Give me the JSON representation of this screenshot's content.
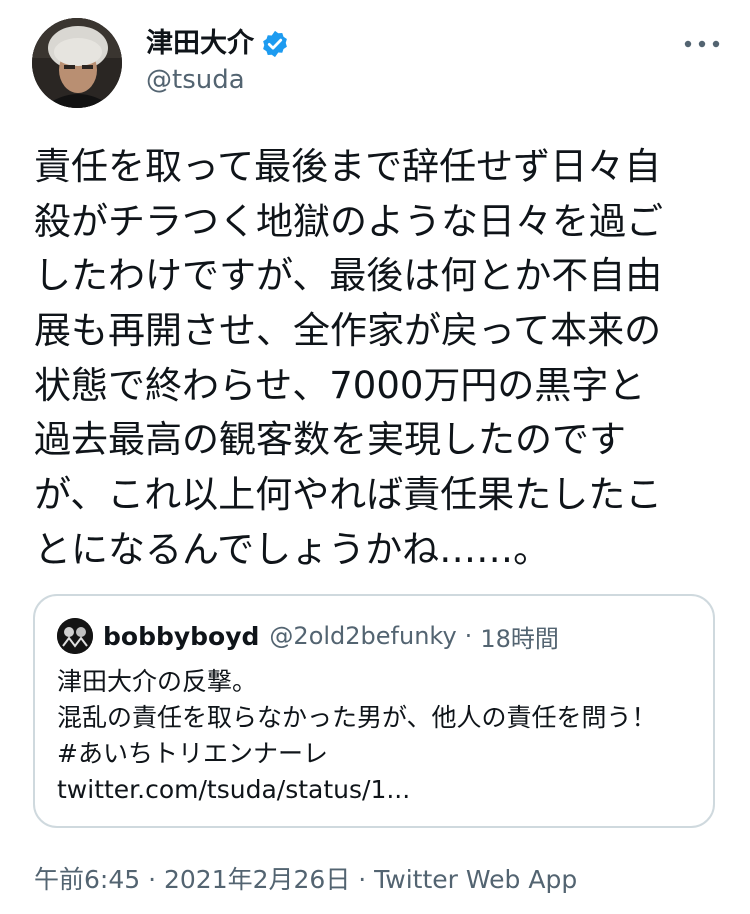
{
  "author": {
    "display_name": "津田大介",
    "handle": "@tsuda",
    "verified": true
  },
  "tweet": {
    "lines": [
      "責任を取って最後まで辞任せず日々自",
      "殺がチラつく地獄のような日々を過ご",
      "したわけですが、最後は何とか不自由",
      "展も再開させ、全作家が戻って本来の",
      "状態で終わらせ、7000万円の黒字と",
      "過去最高の観客数を実現したのです",
      "が、これ以上何やれば責任果たしたこ",
      "とになるんでしょうかね……。"
    ]
  },
  "quoted_tweet": {
    "name": "bobbyboyd",
    "handle": "@2old2befunky",
    "time_sep": "·",
    "time": "18時間",
    "lines": [
      "津田大介の反撃。",
      "混乱の責任を取らなかった男が、他人の責任を問う！",
      "#あいちトリエンナーレ",
      "twitter.com/tsuda/status/1..."
    ]
  },
  "footer": {
    "text": "午前6:45 · 2021年2月26日 · Twitter Web App"
  },
  "colors": {
    "verified_blue": "#1d9bf0",
    "secondary_text": "#536471",
    "border": "#cfd9de"
  },
  "icons": {
    "more": "more-horizontal-icon",
    "verified": "verified-badge-icon"
  }
}
